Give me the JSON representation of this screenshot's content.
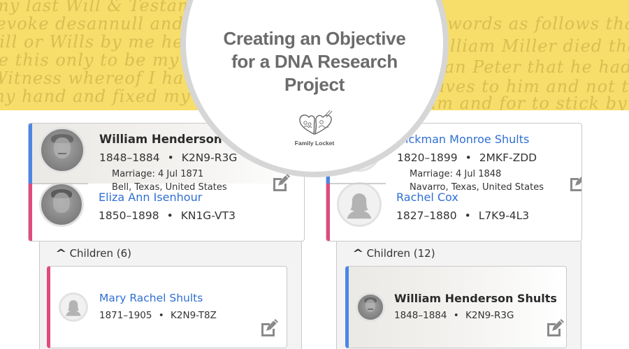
{
  "banner": {
    "script_lines_left": [
      "my last Will & Testament",
      "revoke desannull and de",
      "Will or Wills by me heretofore",
      "are this only to be my last",
      "Witness whereof I have hereunto",
      "my hand and fixed my Sea"
    ],
    "script_lines_right": [
      "words as follows that abou",
      "William Miller died that",
      "man Peter that he had a l",
      "Slaves to him and not to b",
      "him and for to stick by him l"
    ]
  },
  "title_badge": {
    "title_lines": [
      "Creating an Objective",
      "for a DNA Research",
      "Project"
    ],
    "logo_text": "Family Locket",
    "logo_icon": "heart-locket-icon"
  },
  "colors": {
    "banner": "#f7dd6a",
    "male_bar": "#4a86e8",
    "female_bar": "#e24a7d",
    "link": "#2f6fd3",
    "badge_border": "#d6d6d6",
    "title_text": "#6b6b6b"
  },
  "families": [
    {
      "husband": {
        "name": "William Henderson Shults",
        "name_visible": "William Henderson Shu",
        "lifespan": "1848–1884",
        "pid": "K2N9-R3G",
        "has_photo": true,
        "selected": true
      },
      "marriage": {
        "label": "Marriage: 4 Jul 1871",
        "place": "Bell, Texas, United States"
      },
      "wife": {
        "name": "Eliza Ann Isenhour",
        "lifespan": "1850–1898",
        "pid": "KN1G-VT3",
        "has_photo": true
      },
      "children_label": "Children (6)",
      "child": {
        "name": "Mary Rachel Shults",
        "lifespan": "1871–1905",
        "pid": "K2N9-T8Z",
        "gender": "female",
        "has_photo": false
      }
    },
    {
      "husband": {
        "name": "Hickman Monroe Shults",
        "lifespan": "1820–1899",
        "pid": "2MKF-ZDD",
        "has_photo": false
      },
      "marriage": {
        "label": "Marriage: 4 Jul 1848",
        "place": "Navarro, Texas, United States"
      },
      "wife": {
        "name": "Rachel Cox",
        "lifespan": "1827–1880",
        "pid": "L7K9-4L3",
        "has_photo": false
      },
      "children_label": "Children (12)",
      "child": {
        "name": "William Henderson Shults",
        "lifespan": "1848–1884",
        "pid": "K2N9-R3G",
        "gender": "male",
        "has_photo": true,
        "selected": true
      }
    }
  ],
  "separator": "•",
  "icons": {
    "edit": "edit-icon",
    "caret": "chevron-up-icon"
  }
}
